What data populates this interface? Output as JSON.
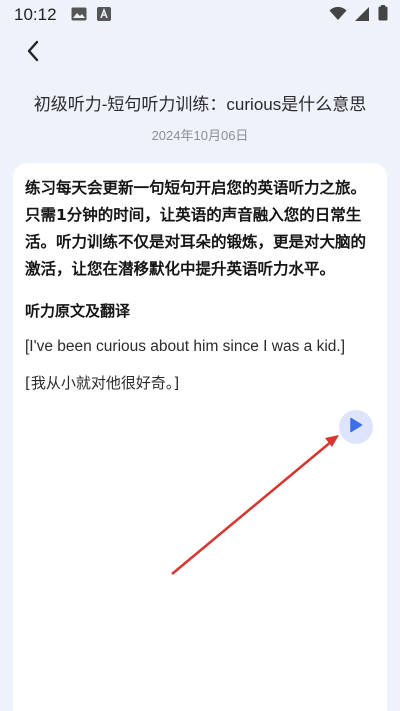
{
  "status_bar": {
    "time": "10:12",
    "left_icons": [
      "image-icon",
      "font-a-icon"
    ],
    "right_icons": [
      "wifi-icon",
      "signal-icon",
      "battery-icon"
    ]
  },
  "header": {
    "back_icon": "chevron-left-icon",
    "title": "初级听力-短句听力训练：curious是什么意思",
    "date": "2024年10月06日"
  },
  "content": {
    "intro": "练习每天会更新一句短句开启您的英语听力之旅。只需1分钟的时间，让英语的声音融入您的日常生活。听力训练不仅是对耳朵的锻炼，更是对大脑的激活，让您在潜移默化中提升英语听力水平。",
    "section_heading": "听力原文及翻译",
    "sentence_en": "[I've been curious about him since I was a kid.]",
    "sentence_zh": "[我从小就对他很好奇。]",
    "play_icon": "play-icon"
  },
  "colors": {
    "background": "#eef2fb",
    "card": "#ffffff",
    "accent": "#3d6fe8",
    "play_bg": "#dde4fb",
    "annotation_arrow": "#d9352f"
  }
}
